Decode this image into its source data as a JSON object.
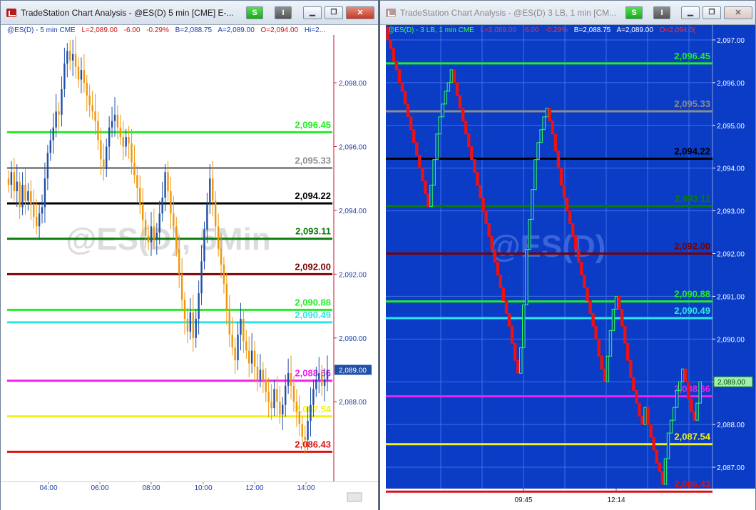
{
  "windows": [
    {
      "title": "TradeStation Chart Analysis - @ES(D) 5 min [CME] E-...",
      "btn_s": "S",
      "btn_i": "I",
      "info_symbol": "@ES(D) - 5 min  CME",
      "info_last": "L=2,089.00",
      "info_change": "-6.00",
      "info_pct": "-0.29%",
      "info_bid": "B=2,088.75",
      "info_ask": "A=2,089.00",
      "info_open": "O=2,094.00",
      "info_hi": "Hi=2...",
      "watermark": "@ES(D), 5Min",
      "price_ticks": [
        "2,098.00",
        "2,096.00",
        "2,094.00",
        "2,092.00",
        "2,090.00",
        "2,088.00"
      ],
      "current_price": "2,089.00",
      "time_labels": [
        "04:00",
        "06:00",
        "08:00",
        "10:00",
        "12:00",
        "14:00"
      ]
    },
    {
      "title": "TradeStation Chart Analysis - @ES(D) 3 LB, 1 min [CM...",
      "btn_s": "S",
      "btn_i": "I",
      "info_symbol": "@ES(D) - 3 LB, 1 min  CME",
      "info_last": "L=2,089.00",
      "info_change": "-6.00",
      "info_pct": "-0.29%",
      "info_bid": "B=2,088.75",
      "info_ask": "A=2,089.00",
      "info_open": "O=2,094.0(",
      "watermark": "@ES(D)",
      "price_ticks": [
        "2,097.00",
        "2,096.00",
        "2,095.00",
        "2,094.00",
        "2,093.00",
        "2,092.00",
        "2,091.00",
        "2,090.00",
        "2,089.00",
        "2,088.00",
        "2,087.00"
      ],
      "current_price": "2,089.00",
      "time_labels": [
        "09:45",
        "12:14"
      ]
    }
  ],
  "levels": [
    {
      "value": 2096.45,
      "label": "2,096.45",
      "color": "#22ee22"
    },
    {
      "value": 2095.33,
      "label": "2,095.33",
      "color": "#8c8c8c"
    },
    {
      "value": 2094.22,
      "label": "2,094.22",
      "color": "#000000"
    },
    {
      "value": 2093.11,
      "label": "2,093.11",
      "color": "#0a7a0a"
    },
    {
      "value": 2092.0,
      "label": "2,092.00",
      "color": "#7a0000"
    },
    {
      "value": 2090.88,
      "label": "2,090.88",
      "color": "#22ee22"
    },
    {
      "value": 2090.49,
      "label": "2,090.49",
      "color": "#2fe6e6"
    },
    {
      "value": 2088.66,
      "label": "2,088.66",
      "color": "#ee22ee"
    },
    {
      "value": 2087.54,
      "label": "2,087.54",
      "color": "#f2f21a"
    },
    {
      "value": 2086.43,
      "label": "2,086.43",
      "color": "#dd1111"
    }
  ],
  "chart_data": [
    {
      "type": "candlestick",
      "symbol": "@ES(D)",
      "interval": "5 min",
      "ylim": [
        2085.5,
        2099.5
      ],
      "x_ticks": [
        "04:00",
        "06:00",
        "08:00",
        "10:00",
        "12:00",
        "14:00"
      ],
      "series": [
        {
          "name": "close",
          "values": [
            2094.8,
            2095.2,
            2094.6,
            2094.9,
            2094.1,
            2094.8,
            2094.3,
            2094.6,
            2094.2,
            2093.8,
            2093.5,
            2093.9,
            2094.1,
            2095.0,
            2095.8,
            2096.2,
            2096.6,
            2097.1,
            2097.0,
            2097.8,
            2098.6,
            2099.0,
            2098.7,
            2098.9,
            2098.5,
            2098.1,
            2098.4,
            2098.0,
            2097.6,
            2097.3,
            2097.1,
            2096.8,
            2096.2,
            2095.6,
            2095.3,
            2096.0,
            2096.6,
            2096.8,
            2097.0,
            2096.6,
            2096.3,
            2096.0,
            2096.3,
            2096.1,
            2095.5,
            2095.1,
            2094.7,
            2094.2,
            2093.7,
            2093.2,
            2093.0,
            2093.5,
            2093.1,
            2093.3,
            2093.9,
            2094.4,
            2095.2,
            2094.6,
            2093.9,
            2093.5,
            2092.8,
            2092.0,
            2091.2,
            2090.6,
            2090.2,
            2090.8,
            2090.0,
            2090.6,
            2091.4,
            2092.4,
            2093.4,
            2094.2,
            2095.0,
            2094.3,
            2093.5,
            2092.8,
            2092.3,
            2091.7,
            2090.9,
            2090.1,
            2089.7,
            2089.3,
            2090.1,
            2090.6,
            2089.9,
            2089.6,
            2089.2,
            2089.6,
            2089.1,
            2088.7,
            2089.0,
            2088.7,
            2088.3,
            2088.0,
            2087.8,
            2088.4,
            2088.0,
            2087.6,
            2087.9,
            2088.5,
            2088.9,
            2088.5,
            2088.0,
            2087.7,
            2087.3,
            2086.9,
            2086.8,
            2087.4,
            2087.9,
            2088.4,
            2088.7,
            2088.9,
            2088.5,
            2088.7,
            2089.0
          ]
        }
      ]
    },
    {
      "type": "line-break",
      "symbol": "@ES(D)",
      "interval": "3 LB, 1 min",
      "ylim": [
        2086.5,
        2097.35
      ],
      "x_ticks": [
        "09:45",
        "12:14"
      ],
      "series": [
        {
          "name": "bricks",
          "values": [
            2097.3,
            2097.0,
            2096.8,
            2096.5,
            2096.3,
            2096.0,
            2095.8,
            2095.5,
            2095.2,
            2094.9,
            2094.6,
            2094.3,
            2094.0,
            2093.7,
            2093.4,
            2093.1,
            2093.6,
            2094.2,
            2094.8,
            2095.2,
            2095.5,
            2095.8,
            2096.0,
            2096.3,
            2096.0,
            2095.7,
            2095.4,
            2095.1,
            2094.8,
            2094.5,
            2094.2,
            2093.9,
            2093.6,
            2093.3,
            2093.0,
            2092.7,
            2092.4,
            2092.1,
            2091.8,
            2091.5,
            2091.2,
            2090.9,
            2090.6,
            2090.3,
            2089.9,
            2089.5,
            2089.2,
            2089.8,
            2090.8,
            2092.1,
            2092.8,
            2093.5,
            2094.2,
            2094.6,
            2094.9,
            2095.2,
            2095.4,
            2095.1,
            2094.8,
            2094.4,
            2094.0,
            2093.6,
            2093.3,
            2093.0,
            2092.7,
            2092.4,
            2092.1,
            2091.8,
            2091.5,
            2091.2,
            2090.9,
            2090.6,
            2090.3,
            2090.0,
            2089.6,
            2089.3,
            2089.0,
            2089.6,
            2090.2,
            2090.7,
            2091.0,
            2090.7,
            2090.3,
            2089.9,
            2089.5,
            2089.1,
            2088.8,
            2088.5,
            2088.2,
            2088.0,
            2088.4,
            2088.0,
            2087.7,
            2087.4,
            2087.1,
            2086.9,
            2086.6,
            2087.2,
            2087.8,
            2088.1,
            2088.4,
            2088.8,
            2089.0,
            2089.3,
            2089.0,
            2088.6,
            2088.3,
            2088.1,
            2088.5,
            2089.0
          ]
        }
      ]
    }
  ]
}
